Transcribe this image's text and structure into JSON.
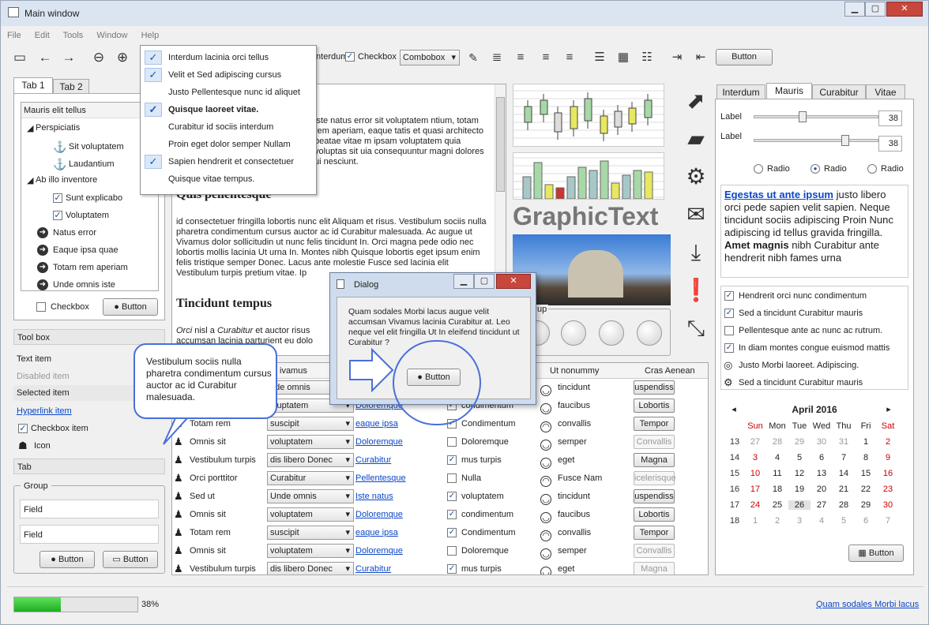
{
  "window": {
    "title": "Main window"
  },
  "menubar": [
    "File",
    "Edit",
    "Tools",
    "Window",
    "Help"
  ],
  "toolbar": {
    "checkbox_partial": "Interdum",
    "checkbox": "Checkbox",
    "combobox": "Combobox",
    "button": "Button"
  },
  "left_tabs": [
    "Tab 1",
    "Tab 2"
  ],
  "tree": {
    "header": "Mauris elit tellus",
    "items": [
      "Perspiciatis",
      "Sit voluptatem",
      "Laudantium",
      "Ab illo inventore",
      "Sunt explicabo",
      "Voluptatem",
      "Natus error",
      "Eaque ipsa quae",
      "Totam rem aperiam",
      "Unde omnis iste"
    ]
  },
  "left_bottom": {
    "checkbox": "Checkbox",
    "button": "Button"
  },
  "toolbox": {
    "title": "Tool box",
    "text_item": "Text item",
    "disabled_item": "Disabled item",
    "selected_item": "Selected item",
    "hyperlink_item": "Hyperlink item",
    "checkbox_item": "Checkbox item",
    "icon": "Icon",
    "tab": "Tab"
  },
  "group": {
    "title": "Group",
    "field1": "Field",
    "field2": "Field",
    "button1": "Button",
    "button2": "Button"
  },
  "popup_menu": {
    "items": [
      {
        "label": "Interdum lacinia orci tellus",
        "checked": true
      },
      {
        "label": "Velit et Sed adipiscing cursus",
        "checked": true
      },
      {
        "label": "Justo Pellentesque nunc id aliquet",
        "checked": false
      },
      {
        "label": "Quisque laoreet vitae.",
        "checked": true,
        "bold": true
      },
      {
        "label": "Curabitur id sociis interdum",
        "checked": false
      },
      {
        "label": "Proin eget dolor semper Nullam",
        "checked": false
      },
      {
        "label": "Sapien hendrerit et consectetuer",
        "checked": true
      },
      {
        "label": "Quisque vitae tempus.",
        "checked": false
      }
    ]
  },
  "document": {
    "para1": "iste natus error sit voluptatem ntium, totam rem aperiam, eaque tatis et quasi architecto beatae vitae m ipsam voluptatem quia voluptas sit uia consequuntur magni dolores ui nesciunt.",
    "heading1": "Quis pellentesque",
    "para2": "id consectetuer fringilla lobortis nunc elit Aliquam et risus. Vestibulum sociis nulla pharetra condimentum cursus auctor ac id Curabitur malesuada. Ac augue ut Vivamus dolor sollicitudin ut nunc felis tincidunt In. Orci magna pede odio nec lobortis mollis lacinia Ut urna In. Montes nibh Quisque lobortis eget ipsum enim felis tristique semper Donec. Lacus ante molestie Fusce sed lacinia elit Vestibulum turpis pretium vitae. Ip",
    "heading2": "Tincidunt tempus",
    "para3a": "Orci",
    "para3b": " nisl a ",
    "para3c": "Curabitur",
    "para3d": " et auctor risus",
    "para3e": "accumsan lacinia parturient eu dolo"
  },
  "graphic_text": "GraphicText",
  "dialog": {
    "title": "Dialog",
    "text": "Quam sodales Morbi lacus augue velit accumsan Vivamus lacinia Curabitur at. Leo neque vel elit fringilla Ut In eleifend tincidunt ut Curabitur ?",
    "button": "Button"
  },
  "bubble_text": "Vestibulum sociis nulla pharetra condimentum cursus auctor ac id Curabitur malesuada.",
  "group_label_partial": "up",
  "table": {
    "headers": [
      "",
      "ivamus",
      "",
      "",
      "Ut nonummy",
      "Cras Aenean"
    ],
    "rows": [
      {
        "name": "",
        "combo": "nde omnis",
        "link": "",
        "check": "",
        "checked": false,
        "smile": "happy",
        "mood": "tincidunt",
        "btn": "uspendiss",
        "dis": false
      },
      {
        "name": "",
        "combo": "oluptatem",
        "link": "Doloremque",
        "check": "condimentum",
        "checked": true,
        "smile": "happy",
        "mood": "faucibus",
        "btn": "Lobortis",
        "dis": false
      },
      {
        "name": "Totam rem",
        "combo": "suscipit",
        "link": "eaque ipsa",
        "check": "Condimentum",
        "checked": true,
        "smile": "sad",
        "mood": "convallis",
        "btn": "Tempor",
        "dis": false
      },
      {
        "name": "Omnis sit",
        "combo": "voluptatem",
        "link": "Doloremque",
        "check": "Doloremque",
        "checked": false,
        "smile": "happy",
        "mood": "semper",
        "btn": "Convallis",
        "dis": true
      },
      {
        "name": "Vestibulum turpis",
        "combo": "dis libero Donec",
        "link": "Curabitur",
        "check": "mus turpis",
        "checked": true,
        "smile": "happy",
        "mood": "eget",
        "btn": "Magna",
        "dis": false
      },
      {
        "name": "Orci porttitor",
        "combo": "Curabitur",
        "link": "Pellentesque",
        "check": "Nulla",
        "checked": false,
        "smile": "sad",
        "mood": "Fusce Nam",
        "btn": "icelerisque",
        "dis": true
      },
      {
        "name": "Sed ut",
        "combo": "Unde omnis",
        "link": "Iste natus",
        "check": "voluptatem",
        "checked": true,
        "smile": "happy",
        "mood": "tincidunt",
        "btn": "uspendiss",
        "dis": false
      },
      {
        "name": "Omnis sit",
        "combo": "voluptatem",
        "link": "Doloremque",
        "check": "condimentum",
        "checked": true,
        "smile": "happy",
        "mood": "faucibus",
        "btn": "Lobortis",
        "dis": false
      },
      {
        "name": "Totam rem",
        "combo": "suscipit",
        "link": "eaque ipsa",
        "check": "Condimentum",
        "checked": true,
        "smile": "sad",
        "mood": "convallis",
        "btn": "Tempor",
        "dis": false
      },
      {
        "name": "Omnis sit",
        "combo": "voluptatem",
        "link": "Doloremque",
        "check": "Doloremque",
        "checked": false,
        "smile": "happy",
        "mood": "semper",
        "btn": "Convallis",
        "dis": true
      },
      {
        "name": "Vestibulum turpis",
        "combo": "dis libero Donec",
        "link": "Curabitur",
        "check": "mus turpis",
        "checked": true,
        "smile": "happy",
        "mood": "eget",
        "btn": "Magna",
        "dis": true
      }
    ]
  },
  "right_tabs": [
    "Interdum",
    "Mauris",
    "Curabitur",
    "Vitae"
  ],
  "sliders": [
    {
      "label": "Label",
      "value": "38",
      "level": 0.38
    },
    {
      "label": "Label",
      "value": "38",
      "level": 0.74
    }
  ],
  "radios": [
    {
      "label": "Radio",
      "checked": false
    },
    {
      "label": "Radio",
      "checked": true
    },
    {
      "label": "Radio",
      "checked": false
    }
  ],
  "richtext": {
    "link": "Egestas ut ante ipsum",
    "t1": " justo libero orci pede sapien velit sapien. Neque tincidunt sociis adipiscing Proin Nunc adipiscing id tellus gravida fringilla. ",
    "bold": "Amet magnis",
    "t2": " nibh Curabitur ante hendrerit nibh fames urna"
  },
  "checklist": [
    {
      "label": "Hendrerit orci nunc condimentum",
      "type": "check",
      "checked": true
    },
    {
      "label": "Sed a tincidunt Curabitur mauris",
      "type": "check",
      "checked": true
    },
    {
      "label": "Pellentesque ante ac nunc ac rutrum.",
      "type": "check",
      "checked": false
    },
    {
      "label": "In diam montes congue euismod mattis",
      "type": "check",
      "checked": true
    },
    {
      "label": "Justo Morbi laoreet. Adipiscing.",
      "type": "compass-icon"
    },
    {
      "label": "Sed a tincidunt Curabitur mauris",
      "type": "gear-icon"
    }
  ],
  "calendar": {
    "month": "April 2016",
    "days": [
      "Sun",
      "Mon",
      "Tue",
      "Wed",
      "Thu",
      "Fri",
      "Sat"
    ],
    "weeks": [
      [
        "13",
        "27",
        "28",
        "29",
        "30",
        "31",
        "1",
        "2"
      ],
      [
        "14",
        "3",
        "4",
        "5",
        "6",
        "7",
        "8",
        "9"
      ],
      [
        "15",
        "10",
        "11",
        "12",
        "13",
        "14",
        "15",
        "16"
      ],
      [
        "16",
        "17",
        "18",
        "19",
        "20",
        "21",
        "22",
        "23"
      ],
      [
        "17",
        "24",
        "25",
        "26",
        "27",
        "28",
        "29",
        "30"
      ],
      [
        "18",
        "1",
        "2",
        "3",
        "4",
        "5",
        "6",
        "7"
      ]
    ],
    "button": "Button"
  },
  "status": {
    "progress": 0.38,
    "progress_label": "38%",
    "link": "Quam sodales Morbi lacus"
  },
  "colors": {
    "accent": "#4a6fd8",
    "link": "#0b47c7",
    "weekend": "#cc0000",
    "progress": "#22c022"
  }
}
